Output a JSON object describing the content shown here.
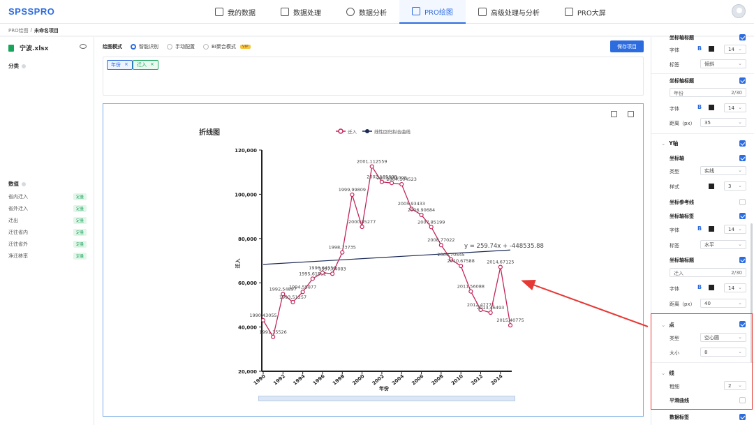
{
  "app": {
    "logo": "SPSSPRO"
  },
  "nav": [
    {
      "label": "我的数据",
      "active": false,
      "icon": "cube-stack-icon"
    },
    {
      "label": "数据处理",
      "active": false,
      "icon": "box-icon"
    },
    {
      "label": "数据分析",
      "active": false,
      "icon": "pie-chart-icon"
    },
    {
      "label": "PRO绘图",
      "active": true,
      "icon": "magic-wand-icon"
    },
    {
      "label": "高级处理与分析",
      "active": false,
      "icon": "sliders-icon"
    },
    {
      "label": "PRO大屏",
      "active": false,
      "icon": "monitor-chart-icon"
    }
  ],
  "breadcrumb": {
    "root": "PRO绘图",
    "sep": "/",
    "current": "未命名项目"
  },
  "left": {
    "file_name": "宁波.xlsx",
    "category_title": "分类",
    "numeric_title": "数值",
    "variables": [
      {
        "name": "省内迁入",
        "tag": "定量"
      },
      {
        "name": "省外迁入",
        "tag": "定量"
      },
      {
        "name": "迁出",
        "tag": "定量"
      },
      {
        "name": "迁往省内",
        "tag": "定量"
      },
      {
        "name": "迁往省外",
        "tag": "定量"
      },
      {
        "name": "净迁移率",
        "tag": "定量"
      }
    ]
  },
  "toolbar": {
    "mode_label": "绘图模式",
    "modes": [
      "智能识别",
      "手动配置",
      "BI聚合模式"
    ],
    "vip": "VIP",
    "save_label": "保存项目"
  },
  "fields": {
    "x_chip": "年份",
    "y_chip": "迁入",
    "remove": "×"
  },
  "chart_data": {
    "type": "line",
    "title": "折线图",
    "xlabel": "年份",
    "ylabel": "迁入",
    "x": [
      1990,
      1991,
      1992,
      1993,
      1994,
      1995,
      1996,
      1997,
      1998,
      1999,
      2000,
      2001,
      2002,
      2003,
      2004,
      2005,
      2006,
      2007,
      2008,
      2009,
      2010,
      2011,
      2012,
      2013,
      2014,
      2015
    ],
    "xticks": [
      1990,
      1992,
      1994,
      1996,
      1998,
      2000,
      2002,
      2004,
      2006,
      2008,
      2010,
      2012,
      2014
    ],
    "ylim": [
      20000,
      120000
    ],
    "yticks": [
      "20,000",
      "40,000",
      "60,000",
      "80,000",
      "100,000",
      "120,000"
    ],
    "series": [
      {
        "name": "迁入",
        "color": "#c2255c",
        "values": [
          43055,
          35526,
          54897,
          51257,
          55877,
          61852,
          64553,
          64083,
          73735,
          99809,
          85277,
          112559,
          105608,
          105098,
          104523,
          93433,
          90684,
          85199,
          77022,
          70545,
          67588,
          56088,
          47771,
          46493,
          67125,
          40775
        ],
        "labels": [
          "1990,43055",
          "1991,35526",
          "1992,54897",
          "1993,51257",
          "1994,55877",
          "1995,61852",
          "1996,64553",
          "1997,64083",
          "1998,73735",
          "1999,99809",
          "2000,85277",
          "2001,112559",
          "2002,105608",
          "2003,105098",
          "2004,104523",
          "2005,93433",
          "2006,90684",
          "2007,85199",
          "2008,77022",
          "2009,70545",
          "2010,67588",
          "2011,56088",
          "2012,47771",
          "2013,46493",
          "2014,67125",
          "2015,40775"
        ]
      },
      {
        "name": "线性回归拟合曲线",
        "color": "#1b2a55",
        "fit_start": [
          1990,
          68300
        ],
        "fit_end": [
          2015,
          74800
        ]
      }
    ],
    "equation": "y = 259.74x + -448535.88"
  },
  "right": {
    "axis_title_top": "坐标轴标题",
    "font": "字体",
    "bold": "B",
    "font_size_a": "14",
    "label": "标签",
    "label_value_x": "倾斜",
    "axis_title": "坐标轴标题",
    "x_title_value": "年份",
    "x_title_count": "2/30",
    "font_size_b": "14",
    "distance": "距离（px）",
    "distance_x": "35",
    "y_group": "Y轴",
    "axis_line": "坐标轴",
    "type": "类型",
    "line_type": "实线",
    "style": "样式",
    "line_width": "3",
    "ref_line": "坐标参考线",
    "tick_label": "坐标轴标签",
    "font_size_c": "14",
    "label_value_y": "水平",
    "y_title": "坐标轴标题",
    "y_title_value": "迁入",
    "y_title_count": "2/30",
    "font_size_d": "14",
    "distance_y": "40",
    "point_group": "点",
    "point_type": "空心圆",
    "size": "大小",
    "point_size": "8",
    "line_group": "线",
    "thickness": "粗细",
    "line_thickness": "2",
    "smooth": "平滑曲线",
    "data_label": "数据标签"
  }
}
